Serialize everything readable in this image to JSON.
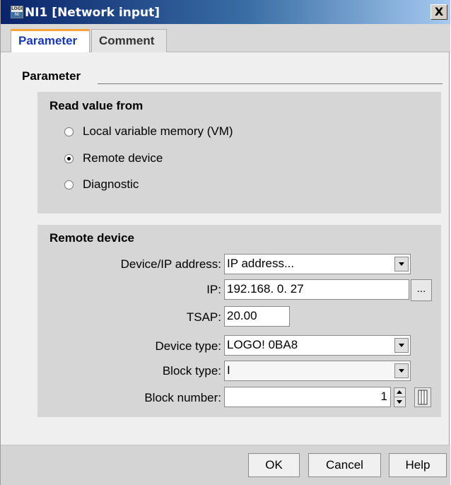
{
  "window": {
    "title": "NI1 [Network input]",
    "icon_text_top": "LOGO",
    "icon_text_bottom": "NI",
    "close_symbol": "X"
  },
  "tabs": [
    {
      "label": "Parameter",
      "active": true
    },
    {
      "label": "Comment",
      "active": false
    }
  ],
  "section": {
    "label": "Parameter"
  },
  "read_value": {
    "title": "Read value from",
    "options": [
      {
        "label": "Local variable memory (VM)",
        "selected": false
      },
      {
        "label": "Remote device",
        "selected": true
      },
      {
        "label": "Diagnostic",
        "selected": false
      }
    ]
  },
  "remote_device": {
    "title": "Remote device",
    "device_ip_label": "Device/IP address:",
    "device_ip_value": "IP address...",
    "ip_label": "IP:",
    "ip_value": "192.168.  0. 27",
    "ip_browse_label": "...",
    "tsap_label": "TSAP:",
    "tsap_value": "20.00",
    "device_type_label": "Device type:",
    "device_type_value": "LOGO! 0BA8",
    "block_type_label": "Block type:",
    "block_type_value": "I",
    "block_number_label": "Block number:",
    "block_number_value": "1"
  },
  "buttons": {
    "ok": "OK",
    "cancel": "Cancel",
    "help": "Help"
  },
  "colors": {
    "titlebar_start": "#0a246a",
    "titlebar_end": "#a6caf0",
    "active_tab_text": "#1a37b0",
    "active_tab_accent": "#f4a43a"
  },
  "icons": [
    "app-logo-icon",
    "close-icon",
    "dropdown-arrow-icon",
    "spinner-icon",
    "block-select-icon"
  ]
}
